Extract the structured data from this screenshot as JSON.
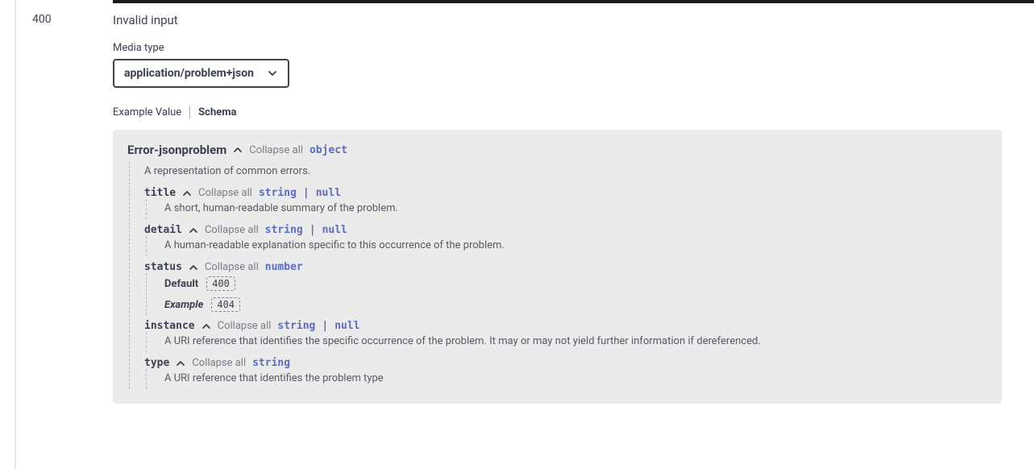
{
  "response": {
    "code": "400",
    "description": "Invalid input",
    "mediaTypeLabel": "Media type",
    "mediaType": "application/problem+json",
    "tabs": {
      "example": "Example Value",
      "schema": "Schema"
    }
  },
  "schema": {
    "title": "Error-jsonproblem",
    "collapse": "Collapse all",
    "rootType": "object",
    "description": "A representation of common errors."
  },
  "props": {
    "title": {
      "name": "title",
      "typeA": "string",
      "typeB": "null",
      "desc": "A short, human-readable summary of the problem."
    },
    "detail": {
      "name": "detail",
      "typeA": "string",
      "typeB": "null",
      "desc": "A human-readable explanation specific to this occurrence of the problem."
    },
    "status": {
      "name": "status",
      "type": "number",
      "defaultLabel": "Default",
      "defaultVal": "400",
      "exampleLabel": "Example",
      "exampleVal": "404"
    },
    "instance": {
      "name": "instance",
      "typeA": "string",
      "typeB": "null",
      "desc": "A URI reference that identifies the specific occurrence of the problem. It may or may not yield further information if dereferenced."
    },
    "type": {
      "name": "type",
      "type": "string",
      "desc": "A URI reference that identifies the problem type"
    }
  },
  "labels": {
    "collapse": "Collapse all",
    "pipe": "|"
  }
}
